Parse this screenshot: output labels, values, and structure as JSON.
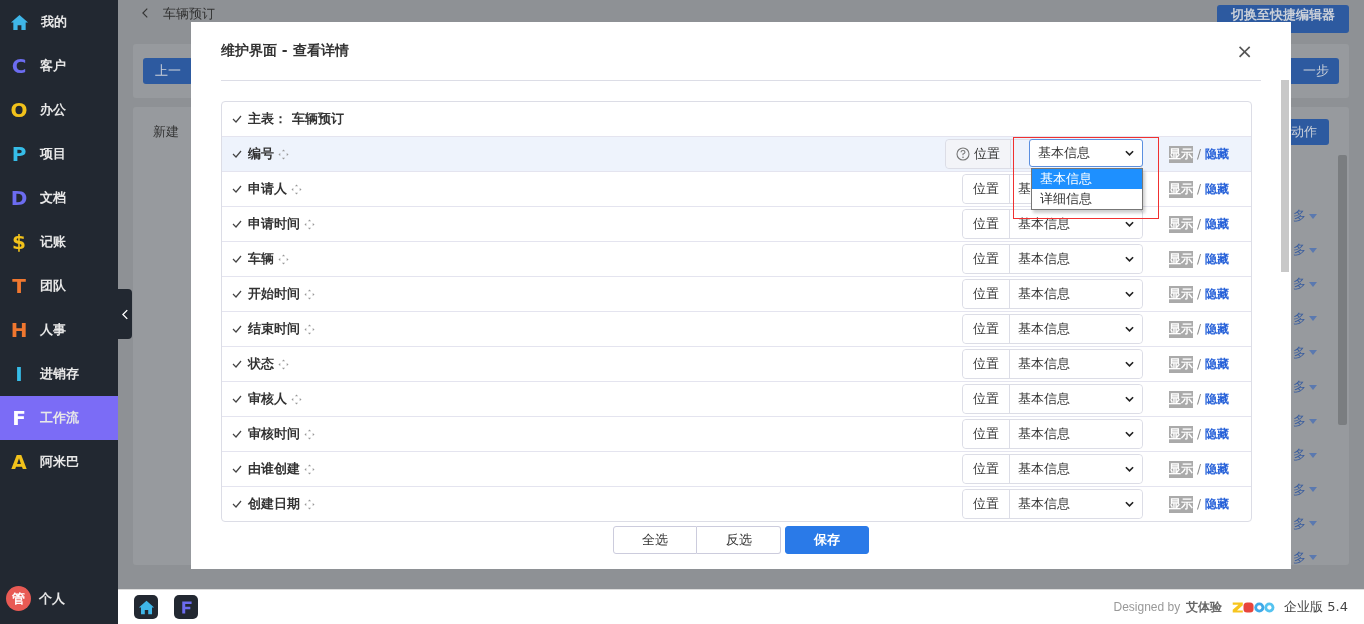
{
  "sidebar": {
    "items": [
      {
        "kind": "home",
        "label": "我的",
        "selected": false,
        "color": "#3fb6e8"
      },
      {
        "kind": "letter",
        "icon": "C",
        "label": "客户",
        "selected": false,
        "color": "#6c6cf0"
      },
      {
        "kind": "letter",
        "icon": "O",
        "label": "办公",
        "selected": false,
        "color": "#f2c21b"
      },
      {
        "kind": "letter",
        "icon": "P",
        "label": "项目",
        "selected": false,
        "color": "#36bde8"
      },
      {
        "kind": "letter",
        "icon": "D",
        "label": "文档",
        "selected": false,
        "color": "#6c6cf0"
      },
      {
        "kind": "letter",
        "icon": "$",
        "label": "记账",
        "selected": false,
        "color": "#f2c21b"
      },
      {
        "kind": "letter",
        "icon": "T",
        "label": "团队",
        "selected": false,
        "color": "#f0772f"
      },
      {
        "kind": "letter",
        "icon": "H",
        "label": "人事",
        "selected": false,
        "color": "#f0772f"
      },
      {
        "kind": "letter",
        "icon": "I",
        "label": "进销存",
        "selected": false,
        "color": "#36bde8"
      },
      {
        "kind": "letter",
        "icon": "F",
        "label": "工作流",
        "selected": true,
        "color": "#ffffff"
      },
      {
        "kind": "letter",
        "icon": "A",
        "label": "阿米巴",
        "selected": false,
        "color": "#f2c21b"
      }
    ],
    "user": {
      "avatar": "管",
      "label": "个人"
    }
  },
  "background": {
    "title": "车辆预订",
    "switch_button": "切换至快捷编辑器",
    "prev_button": "上一",
    "next_button": "一步",
    "tab": "新建",
    "action_button": "动作",
    "more_links": [
      "多",
      "多",
      "多",
      "多",
      "多",
      "多",
      "多",
      "多",
      "多",
      "多",
      "多"
    ]
  },
  "dialog": {
    "title": "维护界面 - 查看详情",
    "close": "×",
    "table": {
      "header": {
        "checked": true,
        "label": "主表： 车辆预订"
      },
      "rows": [
        {
          "checked": true,
          "label": "编号",
          "selected": true,
          "help": true,
          "position": "位置",
          "value": "基本信息",
          "show": "显示",
          "sep": "/",
          "hide": "隐藏",
          "options": [
            {
              "label": "基本信息",
              "selected": true
            },
            {
              "label": "详细信息",
              "selected": false
            }
          ]
        },
        {
          "checked": true,
          "label": "申请人",
          "selected": false,
          "help": false,
          "position": "位置",
          "value": "基",
          "show": "显示",
          "sep": "/",
          "hide": "隐藏"
        },
        {
          "checked": true,
          "label": "申请时间",
          "selected": false,
          "help": false,
          "position": "位置",
          "value": "基本信息",
          "show": "显示",
          "sep": "/",
          "hide": "隐藏"
        },
        {
          "checked": true,
          "label": "车辆",
          "selected": false,
          "help": false,
          "position": "位置",
          "value": "基本信息",
          "show": "显示",
          "sep": "/",
          "hide": "隐藏"
        },
        {
          "checked": true,
          "label": "开始时间",
          "selected": false,
          "help": false,
          "position": "位置",
          "value": "基本信息",
          "show": "显示",
          "sep": "/",
          "hide": "隐藏"
        },
        {
          "checked": true,
          "label": "结束时间",
          "selected": false,
          "help": false,
          "position": "位置",
          "value": "基本信息",
          "show": "显示",
          "sep": "/",
          "hide": "隐藏"
        },
        {
          "checked": true,
          "label": "状态",
          "selected": false,
          "help": false,
          "position": "位置",
          "value": "基本信息",
          "show": "显示",
          "sep": "/",
          "hide": "隐藏"
        },
        {
          "checked": true,
          "label": "审核人",
          "selected": false,
          "help": false,
          "position": "位置",
          "value": "基本信息",
          "show": "显示",
          "sep": "/",
          "hide": "隐藏"
        },
        {
          "checked": true,
          "label": "审核时间",
          "selected": false,
          "help": false,
          "position": "位置",
          "value": "基本信息",
          "show": "显示",
          "sep": "/",
          "hide": "隐藏"
        },
        {
          "checked": true,
          "label": "由谁创建",
          "selected": false,
          "help": false,
          "position": "位置",
          "value": "基本信息",
          "show": "显示",
          "sep": "/",
          "hide": "隐藏"
        },
        {
          "checked": true,
          "label": "创建日期",
          "selected": false,
          "help": false,
          "position": "位置",
          "value": "基本信息",
          "show": "显示",
          "sep": "/",
          "hide": "隐藏"
        }
      ]
    },
    "buttons": [
      {
        "label": "全选",
        "kind": "default"
      },
      {
        "label": "反选",
        "kind": "default"
      },
      {
        "label": "保存",
        "kind": "primary"
      }
    ]
  },
  "footer": {
    "designed_by": "Designed by",
    "designer": "艾体验",
    "edition": "企业版 5.4"
  }
}
